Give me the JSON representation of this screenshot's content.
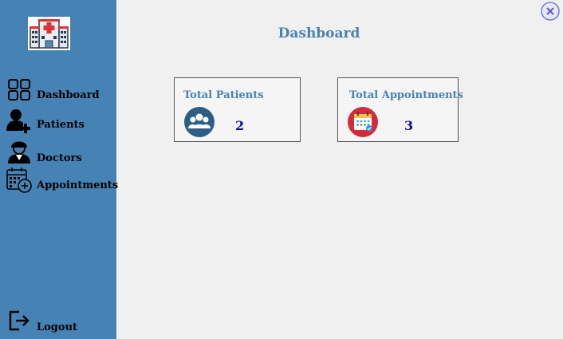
{
  "main": {
    "title": "Dashboard"
  },
  "sidebar": {
    "items": [
      {
        "label": "Dashboard",
        "icon": "dashboard-grid-icon"
      },
      {
        "label": "Patients",
        "icon": "add-user-icon"
      },
      {
        "label": "Doctors",
        "icon": "doctor-icon"
      },
      {
        "label": "Appointments",
        "icon": "calendar-add-icon"
      }
    ],
    "logout": {
      "label": "Logout",
      "icon": "logout-icon"
    }
  },
  "cards": [
    {
      "title": "Total Patients",
      "value": "2",
      "icon": "patients-group-icon"
    },
    {
      "title": "Total Appointments",
      "value": "3",
      "icon": "calendar-icon"
    }
  ],
  "window": {
    "close_icon": "close-icon"
  },
  "colors": {
    "sidebar_bg": "#4682b4",
    "accent": "#4682b4",
    "value_text": "#0b0b9c",
    "background": "#f0f0f0"
  }
}
